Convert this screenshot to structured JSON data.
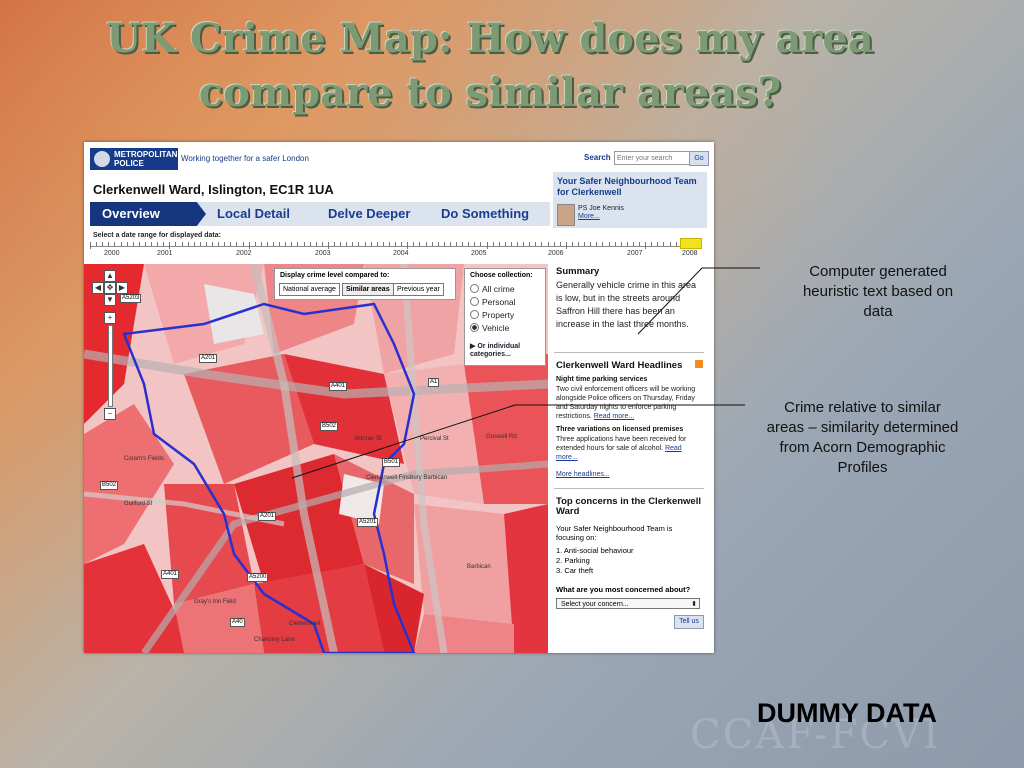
{
  "slide": {
    "title_line1": "UK Crime Map: How does my area",
    "title_line2": "compare to similar areas?",
    "callout_summary": "Computer generated heuristic text based on data",
    "callout_crime": "Crime relative to similar areas – similarity determined from Acorn Demographic Profiles",
    "footer": "DUMMY DATA",
    "watermark": "CCAF-FCVI"
  },
  "site": {
    "logo_line1": "METROPOLITAN",
    "logo_line2": "POLICE",
    "tagline": "Working together for a safer London",
    "search_label": "Search",
    "search_placeholder": "Enter your search",
    "go_label": "Go"
  },
  "ward": {
    "title": "Clerkenwell Ward, Islington, EC1R 1UA"
  },
  "tabs": [
    "Overview",
    "Local Detail",
    "Delve Deeper",
    "Do Something"
  ],
  "timeline": {
    "label": "Select a date range for displayed data:",
    "years": [
      "2000",
      "2001",
      "2002",
      "2003",
      "2004",
      "2005",
      "2006",
      "2007",
      "2008"
    ]
  },
  "map": {
    "compare_label": "Display crime level compared to:",
    "compare_options": [
      "National average",
      "Similar areas",
      "Previous year"
    ],
    "compare_selected": "Similar areas",
    "collection_label": "Choose collection:",
    "collections": [
      "All crime",
      "Personal",
      "Property",
      "Vehicle"
    ],
    "collection_selected": "Vehicle",
    "individual": "Or individual categories...",
    "roads": [
      "A5203",
      "A201",
      "A401",
      "B502",
      "A1",
      "B501",
      "A5201",
      "A5200",
      "B502",
      "A401",
      "A40",
      "A201"
    ],
    "streets": [
      "Clerkenwell Finsbury Barbican",
      "Coram's Fields",
      "Gray's Inn Field",
      "Guilford St",
      "Chancery Lane",
      "Clerkenwell",
      "Barbican",
      "Goswell Rd",
      "Skinner St",
      "Percival St"
    ]
  },
  "sidebar": {
    "team_title": "Your Safer Neighbourhood Team for Clerkenwell",
    "officer": "PS Joe Kennis",
    "more": "More...",
    "summary_heading": "Summary",
    "summary_text": "Generally vehicle crime in this area is low, but in the streets around Saffron Hill there has been an increase in the last three months.",
    "headlines_heading": "Clerkenwell Ward Headlines",
    "headlines": [
      {
        "title": "Night time parking services",
        "text": "Two civil enforcement officers will be working alongside Police officers on Thursday, Friday and Saturday nights to enforce parking restrictions.",
        "link": "Read more..."
      },
      {
        "title": "Three variations on licensed premises",
        "text": "Three applications have been received for extended hours for sale of alcohol.",
        "link": "Read more..."
      }
    ],
    "more_headlines": "More headlines...",
    "concerns_heading": "Top concerns in the Clerkenwell Ward",
    "concerns_intro": "Your Safer Neighbourhood Team is focusing on:",
    "concerns": [
      "1. Anti-social behaviour",
      "2. Parking",
      "3. Car theft"
    ],
    "ask": "What are you most concerned about?",
    "select_placeholder": "Select your concern...",
    "tell_us": "Tell us"
  },
  "colors": {
    "accent": "#153b8a",
    "crime_high": "#e0262b",
    "crime_low": "#f5b9b8",
    "boundary": "#2b2fd0"
  }
}
